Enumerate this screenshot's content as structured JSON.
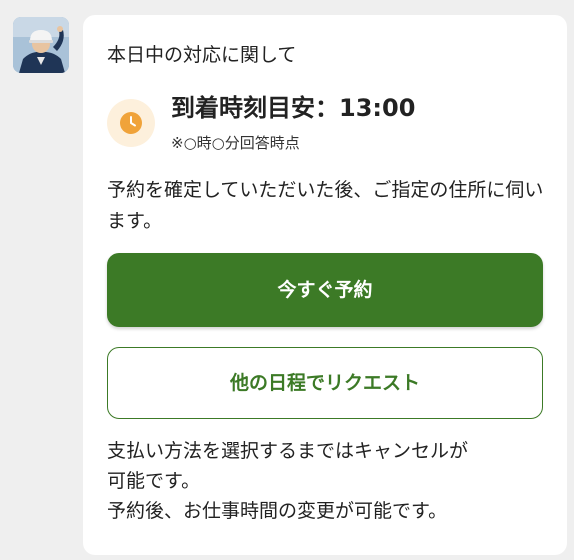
{
  "message": {
    "heading": "本日中の対応に関して",
    "arrival_time": "到着時刻目安：13:00",
    "arrival_note": "※○時○分回答時点",
    "description": "予約を確定していただいた後、ご指定の住所に伺います。",
    "primary_button": "今すぐ予約",
    "secondary_button": "他の日程でリクエスト",
    "footer_lines": [
      "支払い方法を選択するまではキャンセルが",
      "可能です。",
      "予約後、お仕事時間の変更が可能です。"
    ]
  },
  "colors": {
    "brand_green": "#3c7a26",
    "clock_orange": "#f0a33a",
    "clock_badge_bg": "#fdf0dc",
    "page_bg": "#efefef"
  },
  "icons": {
    "avatar": "worker-avatar",
    "clock": "clock-icon"
  }
}
